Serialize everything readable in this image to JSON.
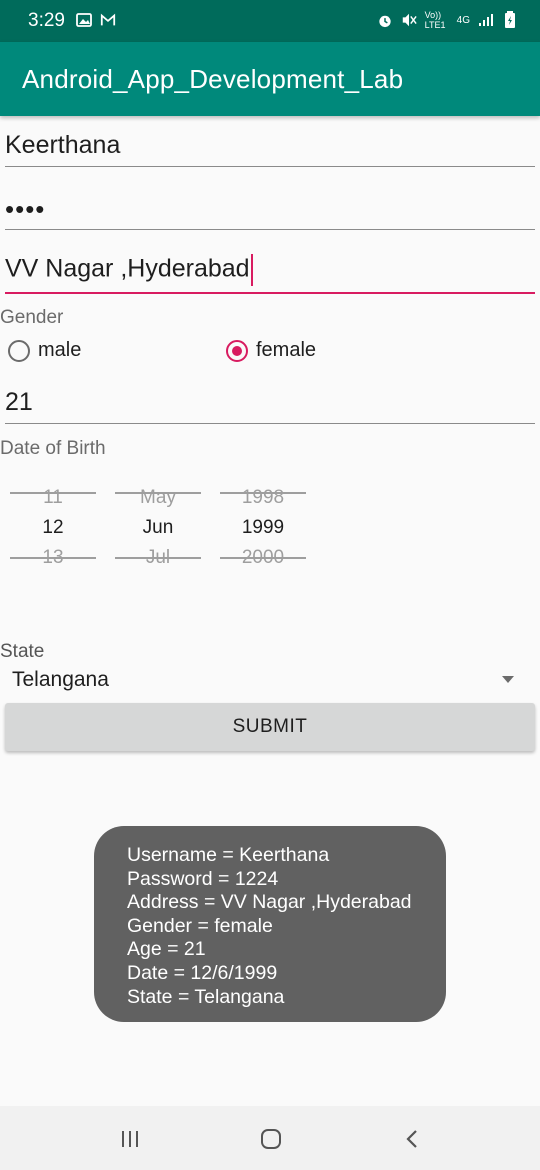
{
  "status_bar": {
    "time": "3:29",
    "left_icons": [
      "image-icon",
      "gmail-icon"
    ],
    "right_icons": [
      "alarm-icon",
      "mute-icon",
      "volte-icon",
      "4g-icon",
      "signal-icon",
      "battery-icon"
    ],
    "volte_label": "Vo)) LTE1",
    "network_label": "4G"
  },
  "app_bar": {
    "title": "Android_App_Development_Lab",
    "color": "#00897b"
  },
  "form": {
    "username": "Keerthana",
    "password_masked": "••••",
    "address": "VV Nagar ,Hyderabad",
    "gender_label": "Gender",
    "gender_options": [
      {
        "label": "male",
        "checked": false
      },
      {
        "label": "female",
        "checked": true
      }
    ],
    "age": "21",
    "dob_label": "Date of Birth",
    "date_picker": {
      "day": {
        "prev": "11",
        "selected": "12",
        "next": "13"
      },
      "month": {
        "prev": "May",
        "selected": "Jun",
        "next": "Jul"
      },
      "year": {
        "prev": "1998",
        "selected": "1999",
        "next": "2000"
      }
    },
    "state_label": "State",
    "state_value": "Telangana",
    "submit_label": "SUBMIT"
  },
  "toast": {
    "lines": [
      "Username = Keerthana",
      "Password = 1224",
      "Address = VV Nagar ,Hyderabad",
      "Gender = female",
      "Age = 21",
      "Date = 12/6/1999",
      "State = Telangana"
    ]
  },
  "nav_bar": {
    "buttons": [
      "recent-apps-icon",
      "home-icon",
      "back-icon"
    ]
  },
  "colors": {
    "accent": "#d81b60",
    "primary_dark": "#006b5b"
  }
}
